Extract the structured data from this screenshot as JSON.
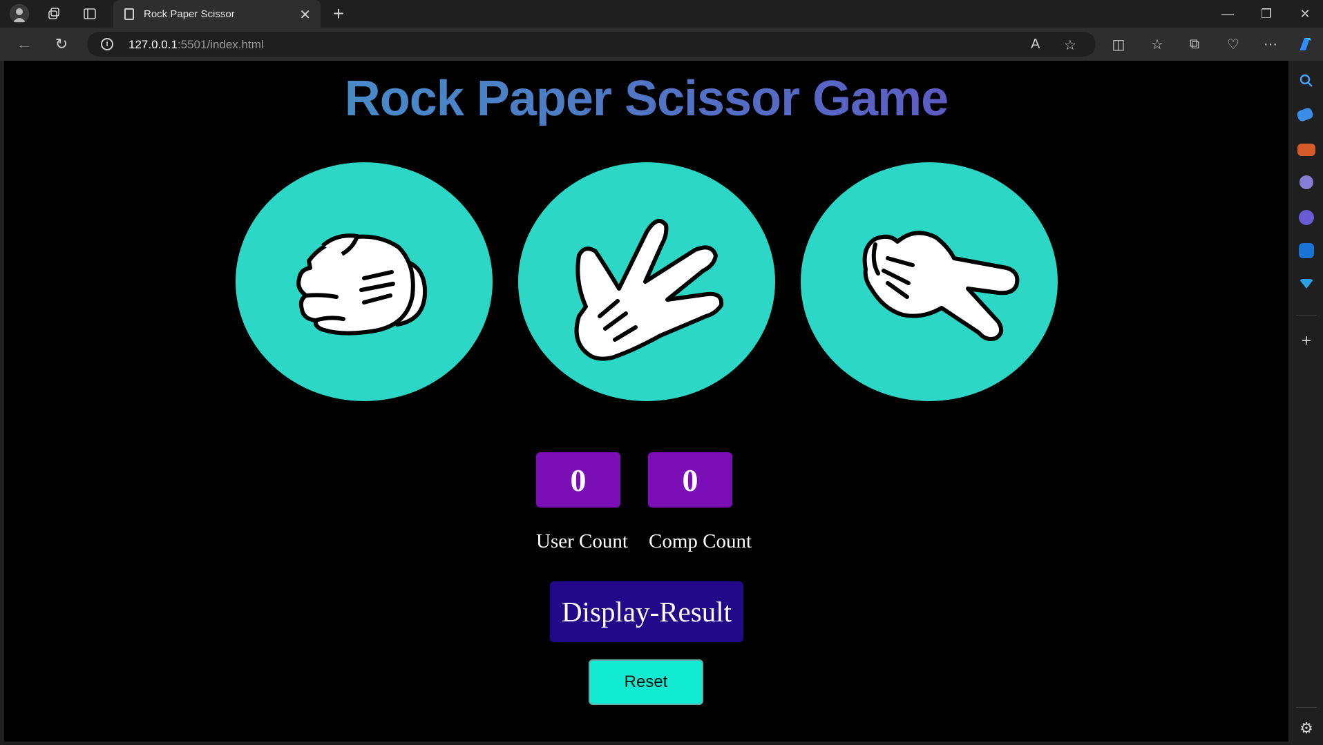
{
  "browser": {
    "tab_title": "Rock Paper Scissor",
    "url_host": "127.0.0.1",
    "url_rest": ":5501/index.html"
  },
  "page": {
    "title": "Rock Paper Scissor Game",
    "choices": [
      {
        "name": "rock",
        "icon": "fist-icon"
      },
      {
        "name": "paper",
        "icon": "open-hand-icon"
      },
      {
        "name": "scissor",
        "icon": "scissors-hand-icon"
      }
    ],
    "user_score": "0",
    "comp_score": "0",
    "user_label": "User Count",
    "comp_label": "Comp Count",
    "display_result_label": "Display-Result",
    "reset_label": "Reset"
  },
  "colors": {
    "choice_bg": "#2dd7c5",
    "score_bg": "#7b0eb6",
    "display_bg": "#22098a",
    "reset_bg": "#10ebd2"
  }
}
